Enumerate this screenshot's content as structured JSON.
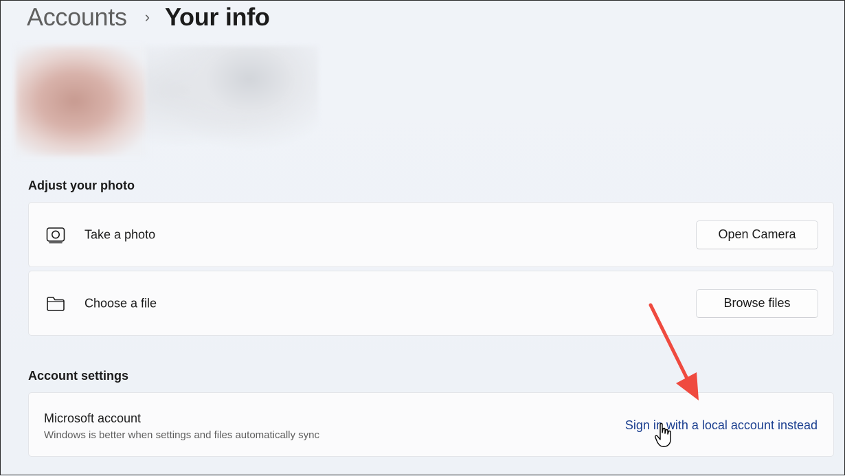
{
  "breadcrumb": {
    "parent": "Accounts",
    "separator": "›",
    "current": "Your info"
  },
  "adjust_photo": {
    "title": "Adjust your photo",
    "take_photo": {
      "label": "Take a photo",
      "icon": "camera-icon",
      "button": "Open Camera"
    },
    "choose_file": {
      "label": "Choose a file",
      "icon": "folder-icon",
      "button": "Browse files"
    }
  },
  "account_settings": {
    "title": "Account settings",
    "microsoft_account": {
      "title": "Microsoft account",
      "subtitle": "Windows is better when settings and files automatically sync",
      "link": "Sign in with a local account instead"
    }
  },
  "colors": {
    "background": "#eef2f7",
    "card": "#fbfbfc",
    "link": "#1a3e8f",
    "annotation_arrow": "#ef4a3f"
  }
}
